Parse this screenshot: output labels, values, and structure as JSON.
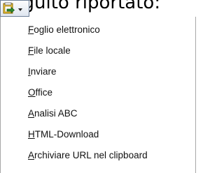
{
  "background": {
    "partial_text": "Seguito riportato:"
  },
  "toolbar": {
    "export_button": {
      "icon": "export-icon",
      "dropdown_icon": "dropdown-arrow-icon"
    }
  },
  "menu": {
    "items": [
      {
        "accel": "F",
        "rest": "oglio elettronico"
      },
      {
        "accel": "F",
        "rest": "ile locale"
      },
      {
        "accel": "I",
        "rest": "nviare"
      },
      {
        "accel": "O",
        "rest": "ffice"
      },
      {
        "accel": "A",
        "rest": "nalisi ABC"
      },
      {
        "accel": "H",
        "rest": "TML-Download"
      },
      {
        "accel": "A",
        "rest": "rchiviare URL nel clipboard"
      }
    ]
  },
  "colors": {
    "menu_border": "#a7a7a7",
    "button_border": "#6d7f98",
    "icon_yellow": "#f3c53a",
    "icon_green": "#2e8b2e"
  }
}
